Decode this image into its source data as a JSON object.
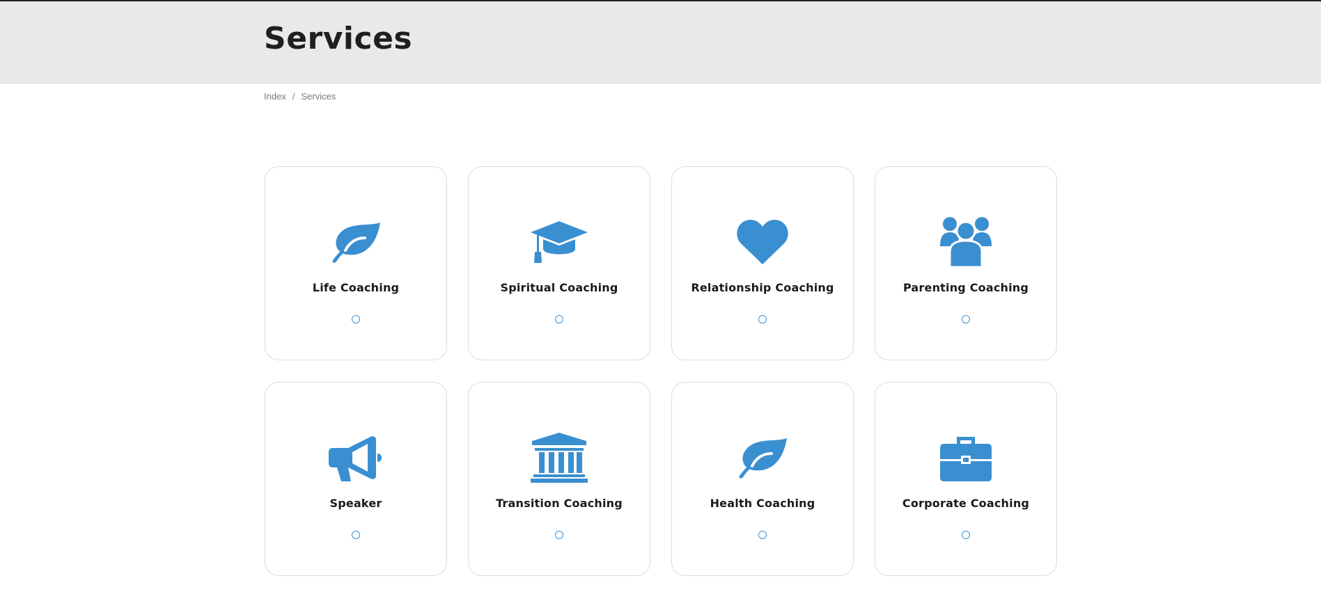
{
  "header": {
    "title": "Services"
  },
  "breadcrumb": {
    "items": [
      "Index",
      "Services"
    ],
    "separator": "/"
  },
  "accent_color": "#3a8fd0",
  "services": [
    {
      "label": "Life Coaching",
      "icon": "leaf-icon"
    },
    {
      "label": "Spiritual Coaching",
      "icon": "graduation-cap-icon"
    },
    {
      "label": "Relationship Coaching",
      "icon": "heart-icon"
    },
    {
      "label": "Parenting Coaching",
      "icon": "users-icon"
    },
    {
      "label": "Speaker",
      "icon": "megaphone-icon"
    },
    {
      "label": "Transition Coaching",
      "icon": "bank-building-icon"
    },
    {
      "label": "Health Coaching",
      "icon": "leaf-icon"
    },
    {
      "label": "Corporate Coaching",
      "icon": "briefcase-icon"
    }
  ]
}
